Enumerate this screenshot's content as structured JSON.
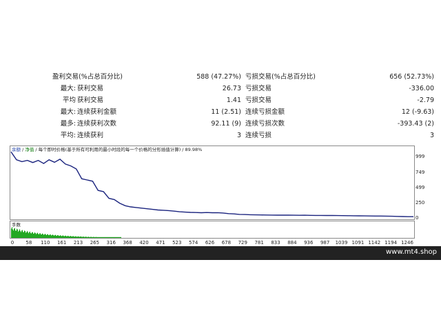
{
  "stats": {
    "rows": [
      {
        "prefix": "",
        "left_label": "盈利交易(%占总百分比)",
        "left_value": "588 (47.27%)",
        "right_label": "亏损交易(%占总百分比)",
        "right_value": "656 (52.73%)"
      },
      {
        "prefix": "最大:",
        "left_label": "获利交易",
        "left_value": "26.73",
        "right_label": "亏损交易",
        "right_value": "-336.00"
      },
      {
        "prefix": "平均",
        "left_label": "获利交易",
        "left_value": "1.41",
        "right_label": "亏损交易",
        "right_value": "-2.79"
      },
      {
        "prefix": "最大:",
        "left_label": "连续获利金额",
        "left_value": "11 (2.51)",
        "right_label": "连续亏损金额",
        "right_value": "12 (-9.63)"
      },
      {
        "prefix": "最多:",
        "left_label": "连续获利次数",
        "left_value": "92.11 (9)",
        "right_label": "连续亏损次数",
        "right_value": "-393.43 (2)"
      },
      {
        "prefix": "平均:",
        "left_label": "连续获利",
        "left_value": "3",
        "right_label": "连续亏损",
        "right_value": "3"
      }
    ]
  },
  "chart": {
    "header": {
      "tab_balance": "余额",
      "sep1": " / ",
      "tab_equity": "净值",
      "sep2": " / ",
      "description": "每个即时价格(基于所有可利用的最小时段的每一个价格的分形插值计算) / 89.98%"
    },
    "volume_label": "手数",
    "colors": {
      "balance": "#1a237e",
      "volume": "#22a822"
    }
  },
  "chart_data": {
    "type": "line",
    "series": [
      {
        "values": [
          1080,
          950,
          920,
          940,
          905,
          940,
          890,
          950,
          910,
          960,
          880,
          850,
          800,
          640,
          620,
          600,
          450,
          430,
          320,
          300,
          240,
          200,
          180,
          170,
          160,
          150,
          140,
          130,
          125,
          120,
          110,
          100,
          95,
          90,
          88,
          85,
          88,
          84,
          86,
          80,
          70,
          65,
          58,
          55,
          52,
          50,
          48,
          47,
          46,
          45,
          46,
          45,
          44,
          43,
          44,
          42,
          41,
          41,
          40,
          39,
          38,
          37,
          36,
          35,
          34,
          33,
          32,
          31,
          30,
          29,
          27,
          25,
          22,
          20,
          20
        ]
      }
    ],
    "x_ticks": [
      "0",
      "58",
      "110",
      "161",
      "213",
      "265",
      "316",
      "368",
      "420",
      "471",
      "523",
      "574",
      "626",
      "678",
      "729",
      "781",
      "833",
      "884",
      "936",
      "987",
      "1039",
      "1091",
      "1142",
      "1194",
      "1246"
    ],
    "y_ticks": [
      "999",
      "749",
      "499",
      "250",
      "0"
    ],
    "ylim": [
      0,
      1150
    ],
    "grid": false
  },
  "footer": {
    "watermark": "www.mt4.shop"
  }
}
